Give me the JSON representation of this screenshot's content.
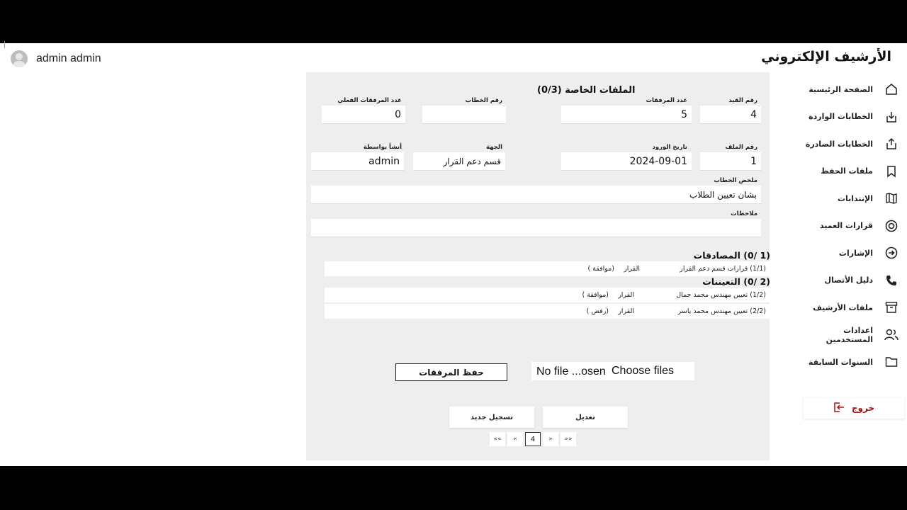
{
  "app": {
    "title": "الأرشيف الإلكتروني"
  },
  "user": {
    "name": "admin admin"
  },
  "nav": {
    "items": [
      {
        "label": "الصفحة الرئيسية",
        "icon": "home-icon"
      },
      {
        "label": "الخطابات الواردة",
        "icon": "inbox-download-icon"
      },
      {
        "label": "الخطابات الصادرة",
        "icon": "share-upload-icon"
      },
      {
        "label": "ملفات الحفظ",
        "icon": "bookmark-icon"
      },
      {
        "label": "الإنتدابات",
        "icon": "map-icon"
      },
      {
        "label": "قرارات العميد",
        "icon": "at-target-icon"
      },
      {
        "label": "الإشارات",
        "icon": "arrow-circle-icon"
      },
      {
        "label": "دليل الأتصال",
        "icon": "phone-icon"
      },
      {
        "label": "ملفات الأرشيف",
        "icon": "archive-box-icon"
      },
      {
        "label": "اعدادات المستخدمين",
        "icon": "users-icon"
      },
      {
        "label": "السنوات السابقة",
        "icon": "folder-icon"
      }
    ],
    "logout": "خروج"
  },
  "form": {
    "title": "الملفات الخاصة (0/3)",
    "fields": {
      "record_no": {
        "label": "رقم القيد",
        "value": "4"
      },
      "attachments_count": {
        "label": "عدد المرفقات",
        "value": "5"
      },
      "letter_no": {
        "label": "رقم الخطاب",
        "value": ""
      },
      "actual_attachments": {
        "label": "عدد المرفقات الفعلي",
        "value": "0"
      },
      "file_no": {
        "label": "رقم الملف",
        "value": "1"
      },
      "arrival_date": {
        "label": "تاريخ الورود",
        "value": "2024-09-01"
      },
      "department": {
        "label": "الجهة",
        "value": "قسم دعم القرار"
      },
      "created_by": {
        "label": "أنشأ بواسطة",
        "value": "admin"
      },
      "summary": {
        "label": "ملخص الخطاب",
        "value": "بشان تعيين الطلاب"
      },
      "notes": {
        "label": "ملاحظات",
        "value": ""
      }
    }
  },
  "approvals": {
    "heading": "(1 /0) المصادقات",
    "rows": [
      {
        "name": "(1/1) قرارات قسم دعم القرار",
        "type": "القرار",
        "status": "(موافقة )"
      }
    ]
  },
  "appointments": {
    "heading": "(2 /0) التعيننات",
    "rows": [
      {
        "name": "(1/2) تعيين مهندس محمد جمال",
        "type": "القرار",
        "status": "(موافقة )"
      },
      {
        "name": "(2/2) تعيين مهندس محمد ياسر",
        "type": "القرار",
        "status": "(رفض )"
      }
    ]
  },
  "attachments": {
    "save_label": "حفظ المرفقات",
    "choose_label": "Choose files",
    "status": "No file ...osen"
  },
  "actions": {
    "edit": "تعديل",
    "new": "تسجيل جديد"
  },
  "pager": {
    "first": "««",
    "prev": "«",
    "current": "4",
    "next": "»",
    "last": "»»"
  }
}
